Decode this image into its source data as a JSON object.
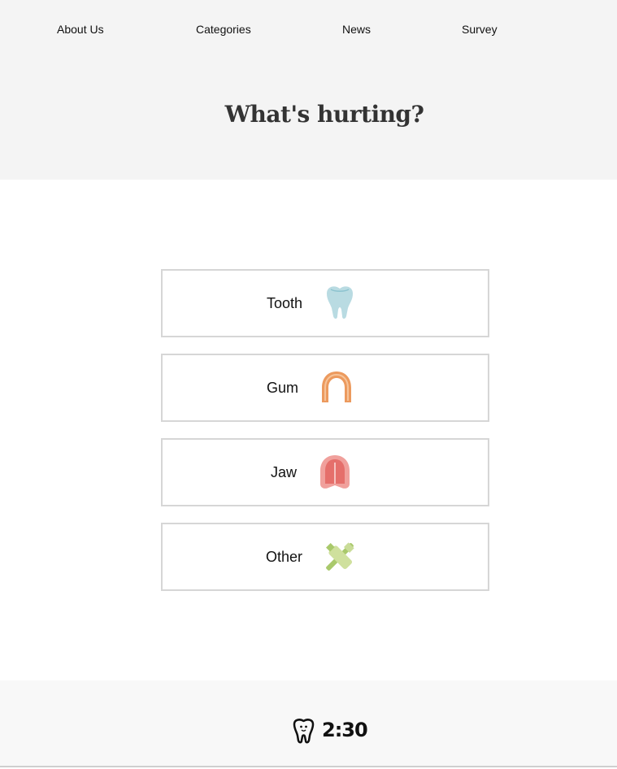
{
  "nav": {
    "items": [
      {
        "label": "About Us"
      },
      {
        "label": "Categories"
      },
      {
        "label": "News"
      },
      {
        "label": "Survey"
      }
    ]
  },
  "hero": {
    "title": "What's hurting?"
  },
  "options": [
    {
      "label": "Tooth",
      "icon": "tooth-icon"
    },
    {
      "label": "Gum",
      "icon": "gum-icon"
    },
    {
      "label": "Jaw",
      "icon": "jaw-icon"
    },
    {
      "label": "Other",
      "icon": "toothbrush-toothpaste-icon"
    }
  ],
  "footer": {
    "logo_text": "2:30",
    "logo_icon": "tooth-logo-icon"
  },
  "colors": {
    "hero_background": "#f4f4f4",
    "footer_background": "#f8f8f8",
    "option_border": "#d6d6d6",
    "title_text": "#333333"
  }
}
